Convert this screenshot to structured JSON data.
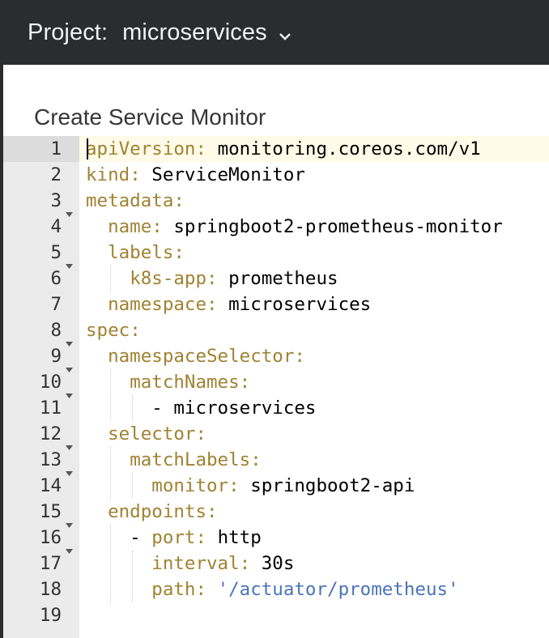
{
  "header": {
    "project_label": "Project:",
    "project_name": "microservices",
    "dropdown_icon": "chevron-down-icon"
  },
  "page": {
    "title": "Create Service Monitor"
  },
  "editor": {
    "active_line": 1,
    "lines": [
      {
        "n": "1",
        "fold": false,
        "indent": "",
        "key": "apiVersion",
        "value": "monitoring.coreos.com/v1",
        "str": ""
      },
      {
        "n": "2",
        "fold": false,
        "indent": "",
        "key": "kind",
        "value": "ServiceMonitor",
        "str": ""
      },
      {
        "n": "3",
        "fold": true,
        "indent": "",
        "key": "metadata",
        "value": "",
        "str": ""
      },
      {
        "n": "4",
        "fold": false,
        "indent": "  ",
        "key": "name",
        "value": "springboot2-prometheus-monitor",
        "str": ""
      },
      {
        "n": "5",
        "fold": true,
        "indent": "  ",
        "key": "labels",
        "value": "",
        "str": ""
      },
      {
        "n": "6",
        "fold": false,
        "indent": "    ",
        "key": "k8s-app",
        "value": "prometheus",
        "str": ""
      },
      {
        "n": "7",
        "fold": false,
        "indent": "  ",
        "key": "namespace",
        "value": "microservices",
        "str": ""
      },
      {
        "n": "8",
        "fold": true,
        "indent": "",
        "key": "spec",
        "value": "",
        "str": ""
      },
      {
        "n": "9",
        "fold": true,
        "indent": "  ",
        "key": "namespaceSelector",
        "value": "",
        "str": ""
      },
      {
        "n": "10",
        "fold": true,
        "indent": "    ",
        "key": "matchNames",
        "value": "",
        "str": ""
      },
      {
        "n": "11",
        "fold": false,
        "indent": "      ",
        "key": "",
        "value": "- microservices",
        "str": ""
      },
      {
        "n": "12",
        "fold": true,
        "indent": "  ",
        "key": "selector",
        "value": "",
        "str": ""
      },
      {
        "n": "13",
        "fold": true,
        "indent": "    ",
        "key": "matchLabels",
        "value": "",
        "str": ""
      },
      {
        "n": "14",
        "fold": false,
        "indent": "      ",
        "key": "monitor",
        "value": "springboot2-api",
        "str": ""
      },
      {
        "n": "15",
        "fold": true,
        "indent": "  ",
        "key": "endpoints",
        "value": "",
        "str": ""
      },
      {
        "n": "16",
        "fold": true,
        "indent": "    - ",
        "key": "port",
        "value": "http",
        "str": ""
      },
      {
        "n": "17",
        "fold": false,
        "indent": "      ",
        "key": "interval",
        "value": "30s",
        "str": ""
      },
      {
        "n": "18",
        "fold": false,
        "indent": "      ",
        "key": "path",
        "value": "",
        "str": "'/actuator/prometheus'"
      },
      {
        "n": "19",
        "fold": false,
        "indent": "",
        "key": "",
        "value": "",
        "str": ""
      }
    ]
  },
  "colors": {
    "topbar": "#2b2c2e",
    "key": "#a08232",
    "string": "#4a74b8",
    "gutter": "#ebebeb",
    "active_line": "#fffbe8"
  }
}
